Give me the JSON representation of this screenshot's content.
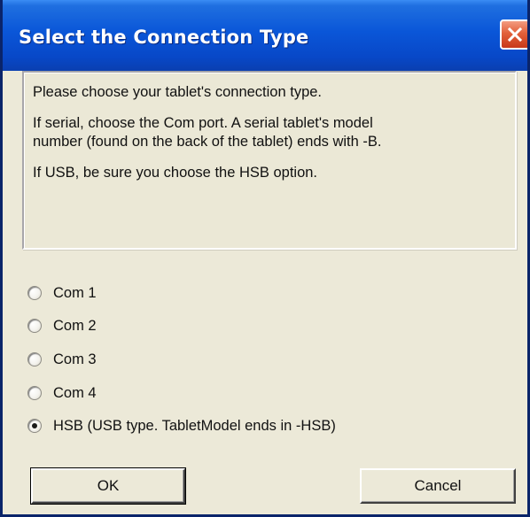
{
  "window": {
    "title": "Select the Connection Type"
  },
  "info": {
    "line1": "Please choose your tablet's connection type.",
    "line2a": "If serial, choose the Com port. A serial tablet's model",
    "line2b": "number (found on the back of the tablet) ends with -B.",
    "line3": "If USB, be sure you choose the HSB option."
  },
  "options": [
    {
      "label": "Com 1",
      "selected": false
    },
    {
      "label": "Com 2",
      "selected": false
    },
    {
      "label": "Com 3",
      "selected": false
    },
    {
      "label": "Com 4",
      "selected": false
    },
    {
      "label": "HSB (USB type. TabletModel ends in -HSB)",
      "selected": true
    }
  ],
  "buttons": {
    "ok": "OK",
    "cancel": "Cancel"
  },
  "icons": {
    "close": "close-icon"
  },
  "colors": {
    "titlebar": "#0a56d8",
    "close_button": "#e2603a",
    "dialog_background": "#ece9d8"
  }
}
